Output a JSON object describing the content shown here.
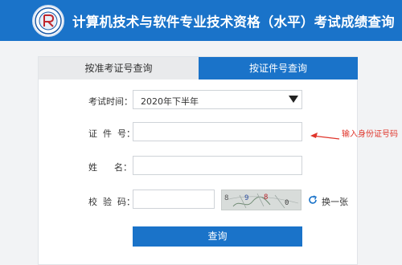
{
  "header": {
    "title": "计算机技术与软件专业技术资格（水平）考试成绩查询",
    "logo_icon": "exam-seal-logo"
  },
  "tabs": [
    {
      "label": "按准考证号查询",
      "active": false
    },
    {
      "label": "按证件号查询",
      "active": true
    }
  ],
  "form": {
    "exam_time_label": "考试时间：",
    "exam_time_value": "2020年下半年",
    "id_label": "证  件  号：",
    "id_value": "",
    "name_label": "姓      名：",
    "name_value": "",
    "captcha_label": "校  验  码：",
    "captcha_value": "",
    "captcha_chars": [
      "8",
      "9",
      "8",
      "0"
    ],
    "refresh_label": "换一张",
    "submit_label": "查询"
  },
  "annotation": {
    "text": "输入身份证号码",
    "color": "#e0352b"
  },
  "colors": {
    "brand": "#1a73c9",
    "tab_inactive": "#e9eaec",
    "background": "#f2f3f5"
  }
}
